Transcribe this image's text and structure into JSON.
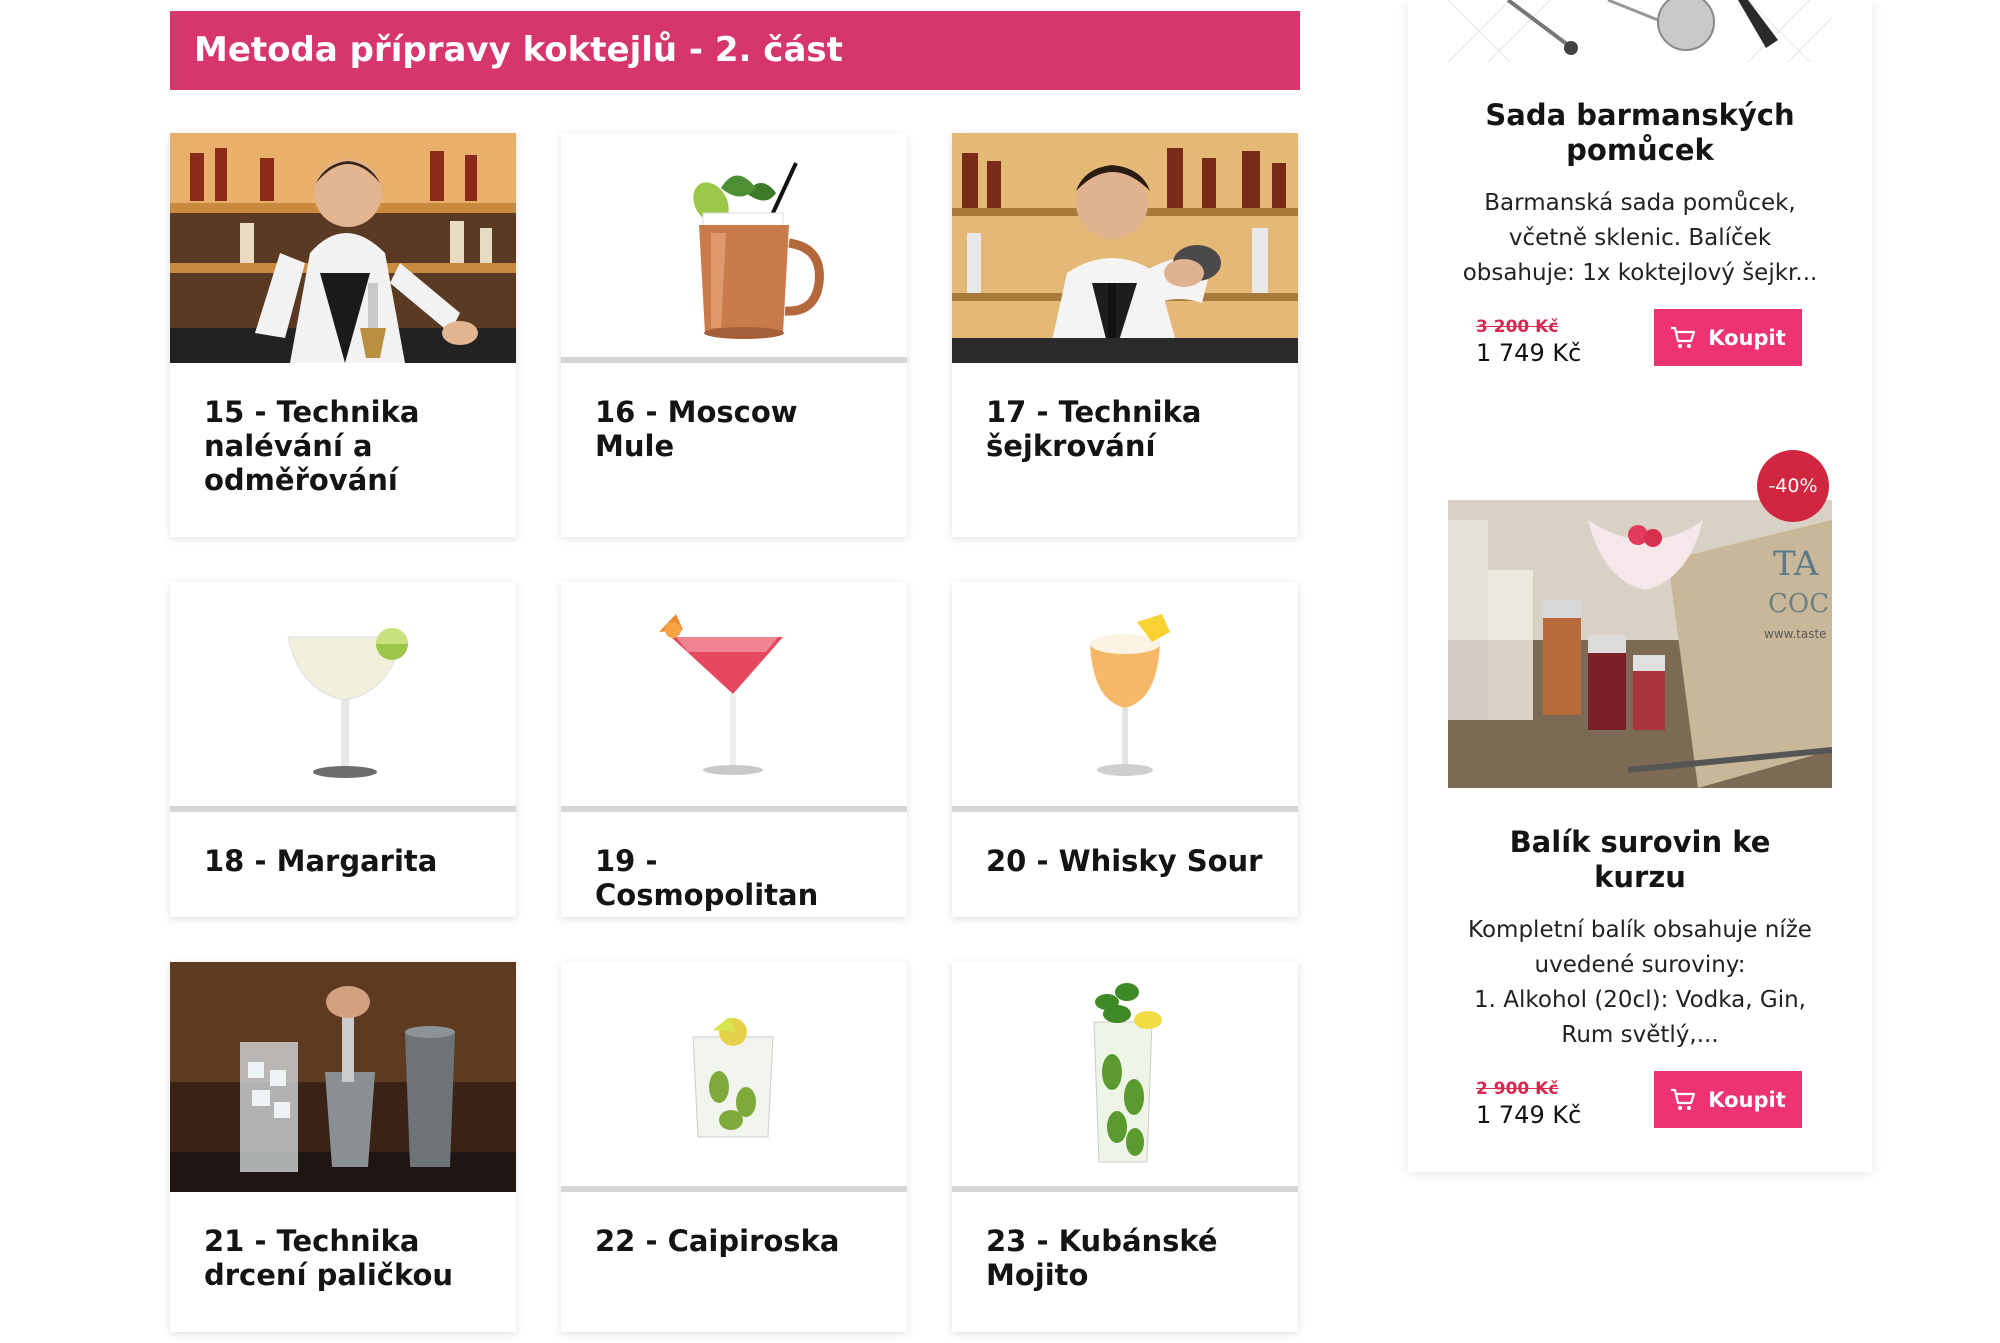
{
  "section": {
    "title": "Metoda přípravy koktejlů - 2. část"
  },
  "lessons": [
    {
      "title": "15 - Technika nalévání a odměřování"
    },
    {
      "title": "16 - Moscow Mule"
    },
    {
      "title": "17 - Technika šejkrování"
    },
    {
      "title": "18 - Margarita"
    },
    {
      "title": "19 - Cosmopolitan"
    },
    {
      "title": "20 - Whisky Sour"
    },
    {
      "title": "21 - Technika drcení paličkou"
    },
    {
      "title": "22 - Caipiroska"
    },
    {
      "title": "23 - Kubánské Mojito"
    }
  ],
  "products": [
    {
      "title": "Sada barmanských pomůcek",
      "description": "Barmanská sada pomůcek, včetně sklenic. Balíček obsahuje: 1x koktejlový šejkr...",
      "old_price": "3 200 Kč",
      "price": "1 749 Kč",
      "buy_label": "Koupit"
    },
    {
      "title": "Balík surovin ke kurzu",
      "description_line1": "Kompletní balík obsahuje níže uvedené suroviny:",
      "description_line2": "1. Alkohol (20cl): Vodka, Gin, Rum světlý,...",
      "old_price": "2 900 Kč",
      "price": "1 749 Kč",
      "buy_label": "Koupit",
      "badge": "-40%",
      "image_text_1": "TA",
      "image_text_2": "COC",
      "image_text_3": "www.taste"
    }
  ],
  "colors": {
    "accent": "#d6366a",
    "button": "#ed3470",
    "badge": "#d0263f",
    "old_price": "#d6294f"
  }
}
